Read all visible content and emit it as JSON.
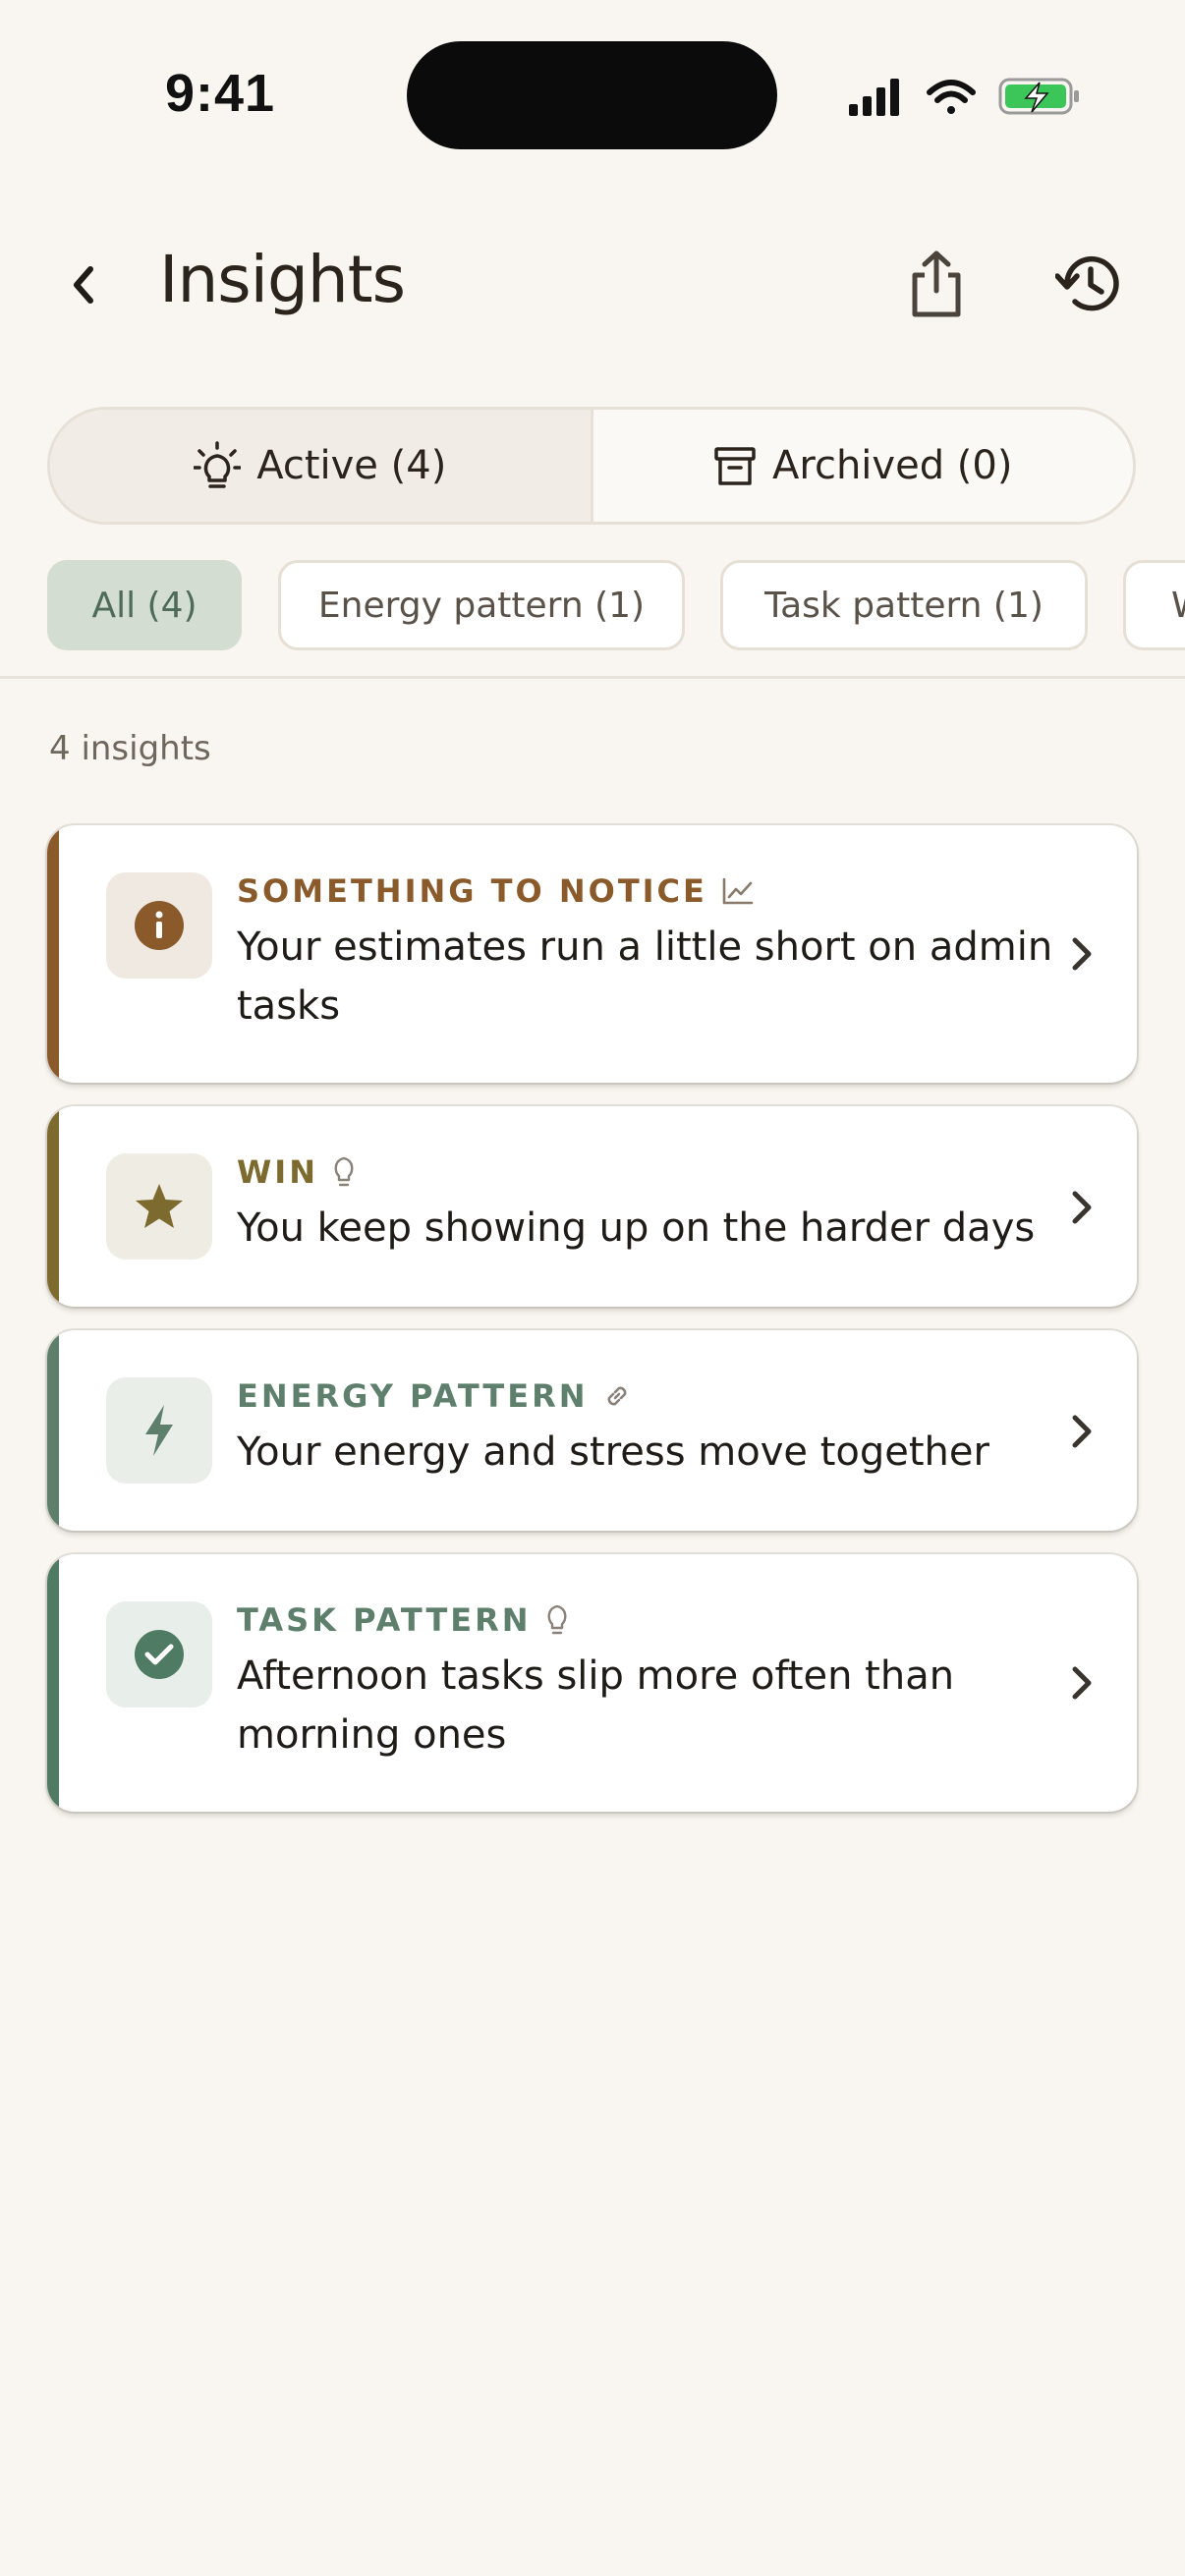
{
  "status_bar": {
    "time": "9:41"
  },
  "header": {
    "title": "Insights",
    "back_icon": "chevron-left-icon",
    "share_icon": "share-icon",
    "history_icon": "history-icon"
  },
  "segments": [
    {
      "label": "Active (4)",
      "icon": "lightbulb-icon",
      "selected": true
    },
    {
      "label": "Archived (0)",
      "icon": "archive-icon",
      "selected": false
    }
  ],
  "filters": [
    {
      "label": "All (4)",
      "selected": true
    },
    {
      "label": "Energy pattern (1)",
      "selected": false
    },
    {
      "label": "Task pattern (1)",
      "selected": false
    },
    {
      "label": "W",
      "selected": false
    }
  ],
  "insights_count": "4 insights",
  "insights": [
    {
      "category": "SOMETHING TO NOTICE",
      "category_icon": "trend-chart-icon",
      "title_line1": "Your estimates run a little short on admin",
      "title_line2": "tasks",
      "icon": "info-icon",
      "accent": "#8a5a2b"
    },
    {
      "category": "WIN",
      "category_icon": "lightbulb-icon",
      "title_line1": "You keep showing up on the harder days",
      "icon": "star-icon",
      "accent": "#7d6a2e"
    },
    {
      "category": "ENERGY PATTERN",
      "category_icon": "link-icon",
      "title_line1": "Your energy and stress move together",
      "icon": "lightning-icon",
      "accent": "#5d7f6c"
    },
    {
      "category": "TASK PATTERN",
      "category_icon": "lightbulb-icon",
      "title_line1": "Afternoon tasks slip more often than",
      "title_line2": "morning ones",
      "icon": "check-circle-icon",
      "accent": "#4f7a63"
    }
  ],
  "colors": {
    "background": "#f9f6f1",
    "chip_selected": "#d3ddd2",
    "brown_accent": "#8a5a2b",
    "olive_accent": "#7d6a2e",
    "green_accent": "#5d7f6c"
  }
}
